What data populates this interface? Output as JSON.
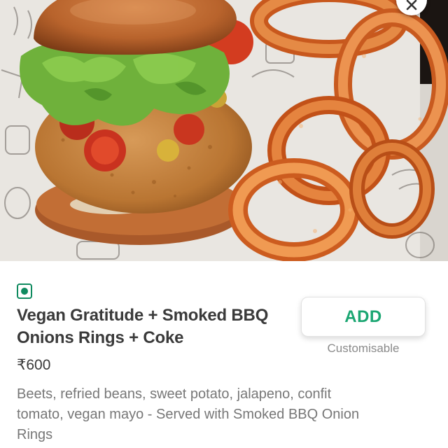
{
  "item": {
    "photo_alt": "",
    "veg_indicator": "veg-icon",
    "name": "Vegan Gratitude + Smoked BBQ Onions Rings + Coke",
    "price": "₹600",
    "description": "Beets, refried beans, sweet potato, jalapeno, confit tomato, vegan mayo - Served with Smoked BBQ Onion Rings"
  },
  "actions": {
    "add_label": "ADD",
    "customisable_label": "Customisable",
    "close_icon": "close-icon"
  },
  "colors": {
    "veg_green": "#0f8a5f",
    "add_green": "#1ba672",
    "title_text": "#3a3a3a",
    "body_text": "#777777"
  }
}
